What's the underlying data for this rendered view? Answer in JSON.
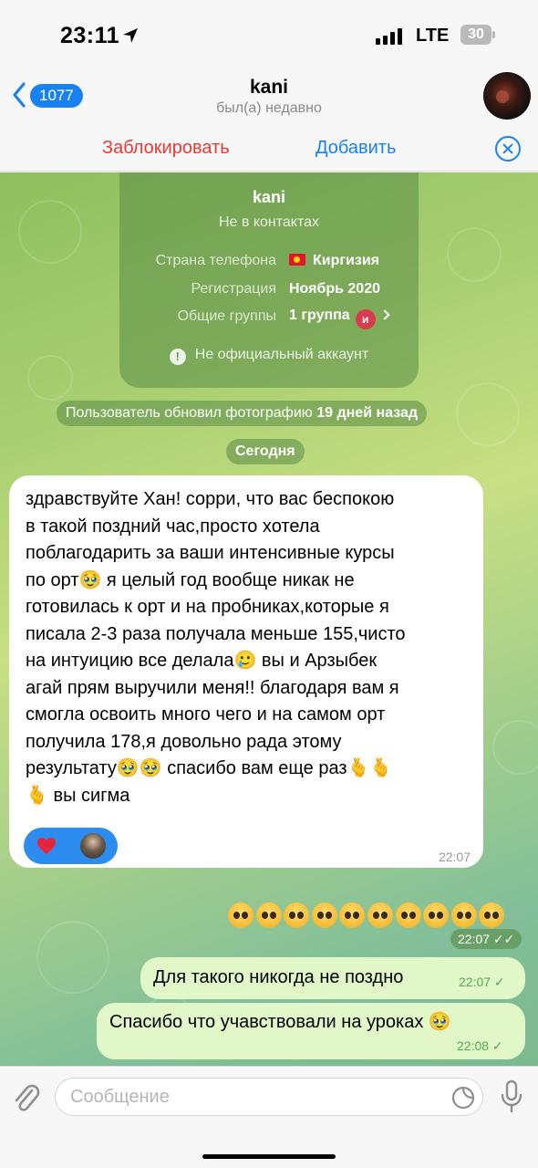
{
  "status_bar": {
    "time": "23:11",
    "network": "LTE",
    "battery": "30"
  },
  "header": {
    "back_count": "1077",
    "title": "kani",
    "subtitle": "был(а) недавно"
  },
  "action_bar": {
    "block_label": "Заблокировать",
    "add_label": "Добавить"
  },
  "info_card": {
    "name": "kani",
    "status": "Не в контактах",
    "rows": [
      {
        "label": "Страна телефона",
        "value": "Киргизия"
      },
      {
        "label": "Регистрация",
        "value": "Ноябрь 2020"
      },
      {
        "label": "Общие группы",
        "value": "1 группа",
        "group_initial": "и"
      }
    ],
    "warning": "Не официальный аккаунт"
  },
  "service_messages": {
    "photo_update": "Пользователь обновил фотографию",
    "photo_update_when": "19 дней назад",
    "date": "Сегодня"
  },
  "messages": [
    {
      "direction": "incoming",
      "text": "здравствуйте Хан! сорри, что вас беспокою\nв такой поздний час,просто хотела\nпоблагодарить за ваши интенсивные курсы\nпо орт🥹 я целый год вообще никак не\nготовилась к орт и на пробниках,которые я\nписала 2-3 раза получала меньше 155,чисто\nна интуицию все делала🥲 вы и Арзыбек\nагай прям выручили меня!! благодаря вам я\nсмогла освоить много чего и на самом орт\nполучила 178,я довольно рада этому\nрезультату🥹🥹 спасибо вам еще раз🫰🫰\n🫰 вы сигма",
      "time": "22:07",
      "reaction": "heart"
    },
    {
      "direction": "outgoing",
      "emoji_count": 10,
      "time": "22:07"
    },
    {
      "direction": "outgoing",
      "text": "Для такого никогда не поздно",
      "time": "22:07"
    },
    {
      "direction": "outgoing",
      "text": "Спасибо что учавствовали на уроках 🥹",
      "time": "22:08"
    }
  ],
  "input_bar": {
    "placeholder": "Сообщение"
  },
  "colors": {
    "accent": "#1a82f0",
    "danger": "#e53935",
    "outgoing_bubble": "#e1f7c7"
  }
}
